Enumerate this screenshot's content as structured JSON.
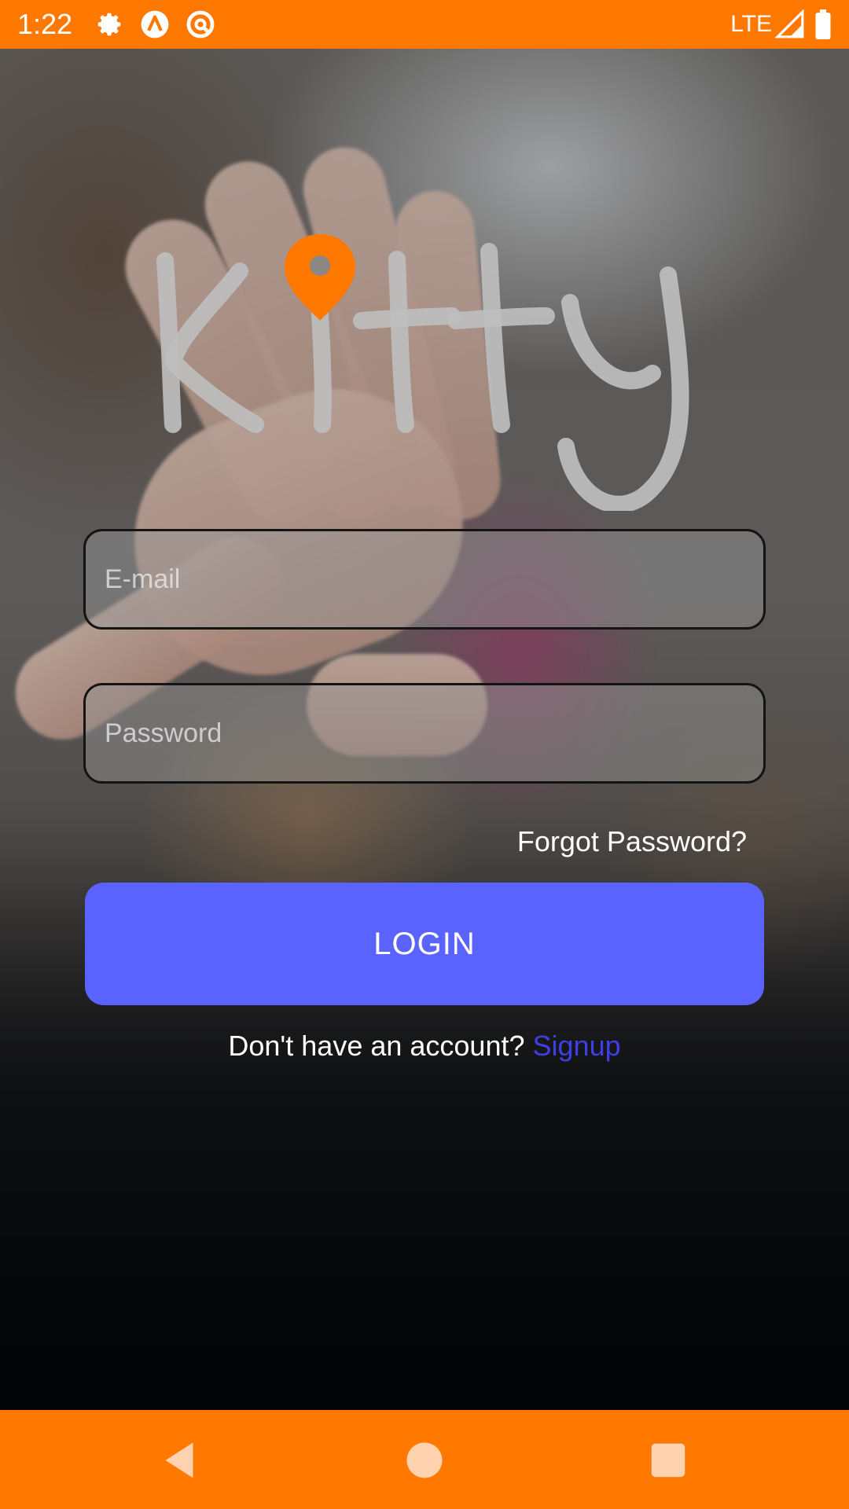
{
  "status_bar": {
    "time": "1:22",
    "network": "LTE",
    "icons": [
      "gear-icon",
      "android-studio-icon",
      "no-disturb-icon",
      "signal-icon",
      "battery-icon"
    ]
  },
  "logo": {
    "text": "kitty",
    "pin_color": "#ff7800"
  },
  "form": {
    "email_placeholder": "E-mail",
    "password_placeholder": "Password",
    "forgot_label": "Forgot Password?",
    "login_label": "LOGIN",
    "signup_prompt": "Don't have an account?",
    "signup_label": "Signup"
  },
  "colors": {
    "accent": "#ff7800",
    "button": "#5b63ff",
    "link": "#3f3fe8"
  },
  "nav_bar": {
    "icons": [
      "back-icon",
      "home-icon",
      "recents-icon"
    ]
  }
}
